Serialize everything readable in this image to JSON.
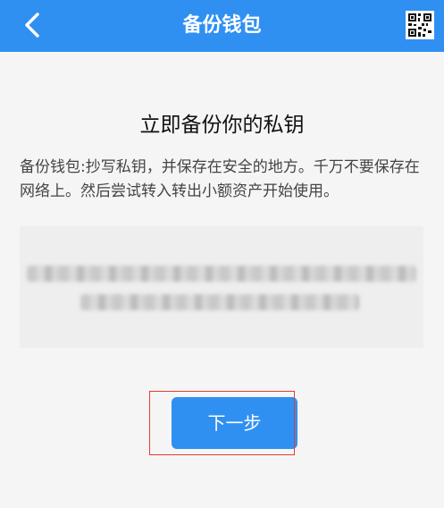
{
  "header": {
    "title": "备份钱包",
    "back_icon": "chevron-left-icon",
    "qr_icon": "qr-code-icon"
  },
  "main": {
    "heading": "立即备份你的私钥",
    "description": "备份钱包:抄写私钥，并保存在安全的地方。千万不要保存在网络上。然后尝试转入转出小额资产开始使用。",
    "private_key_value": "",
    "next_label": "下一步"
  },
  "colors": {
    "accent": "#2f90f2",
    "background": "#f5f5f5",
    "key_box": "#eeeeee",
    "highlight_border": "#e53935"
  }
}
